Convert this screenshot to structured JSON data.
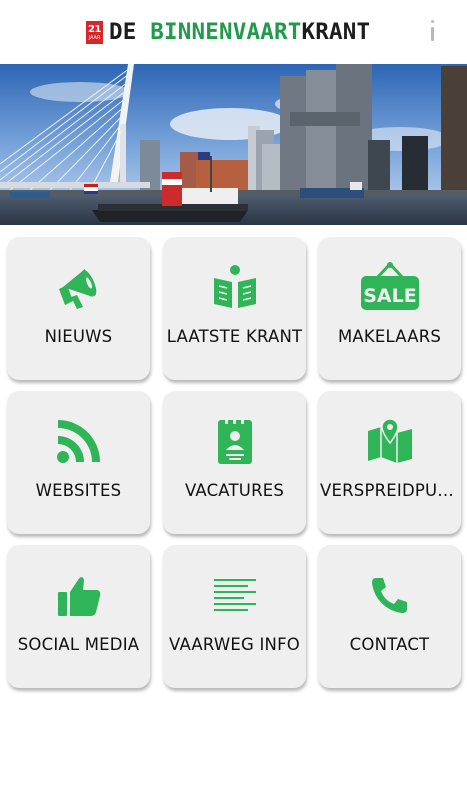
{
  "header": {
    "logo": {
      "badge_number": "21",
      "badge_sub": "JAAR",
      "word_de": "DE ",
      "word_binnenvaart": "BINNENVAART",
      "word_krant": "KRANT"
    },
    "menu_icon": "overflow-menu-icon"
  },
  "hero": {
    "description_icon": "rotterdam-harbor-photo"
  },
  "colors": {
    "accent_green": "#2fb457",
    "logo_red": "#d7262b",
    "tile_bg": "#efefef"
  },
  "tiles": [
    {
      "label": "NIEUWS",
      "icon": "megaphone-icon"
    },
    {
      "label": "LAATSTE KRANT",
      "icon": "open-book-icon"
    },
    {
      "label": "MAKELAARS",
      "icon": "sale-sign-icon"
    },
    {
      "label": "WEBSITES",
      "icon": "rss-icon"
    },
    {
      "label": "VACATURES",
      "icon": "id-badge-icon"
    },
    {
      "label": "VERSPREIDPUNTEN",
      "icon": "map-pin-icon"
    },
    {
      "label": "SOCIAL MEDIA",
      "icon": "thumbs-up-icon"
    },
    {
      "label": "VAARWEG INFO",
      "icon": "text-lines-icon"
    },
    {
      "label": "CONTACT",
      "icon": "phone-icon"
    }
  ]
}
